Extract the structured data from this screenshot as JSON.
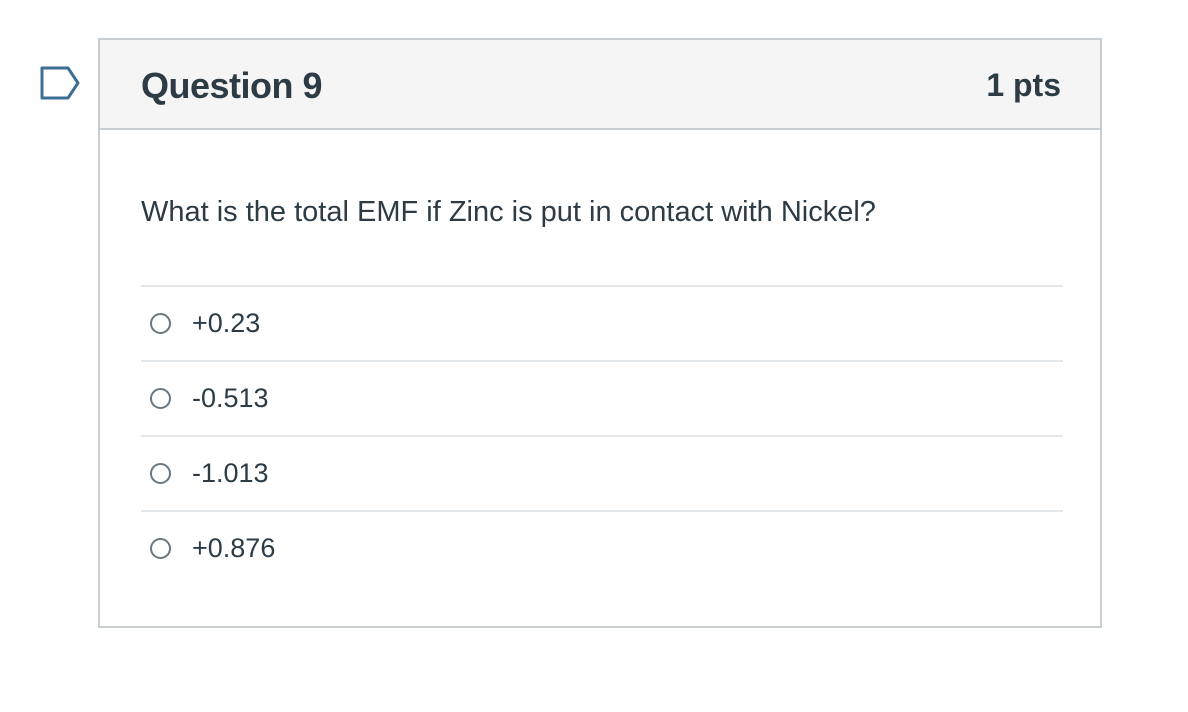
{
  "question": {
    "title": "Question 9",
    "points": "1 pts",
    "text": "What is the total EMF if Zinc is put in contact with Nickel?",
    "answers": [
      {
        "label": "+0.23",
        "selected": false
      },
      {
        "label": "-0.513",
        "selected": false
      },
      {
        "label": "-1.013",
        "selected": false
      },
      {
        "label": "+0.876",
        "selected": false
      }
    ]
  },
  "flag": {
    "icon": "flag-question-icon",
    "color": "#3d6f94"
  }
}
